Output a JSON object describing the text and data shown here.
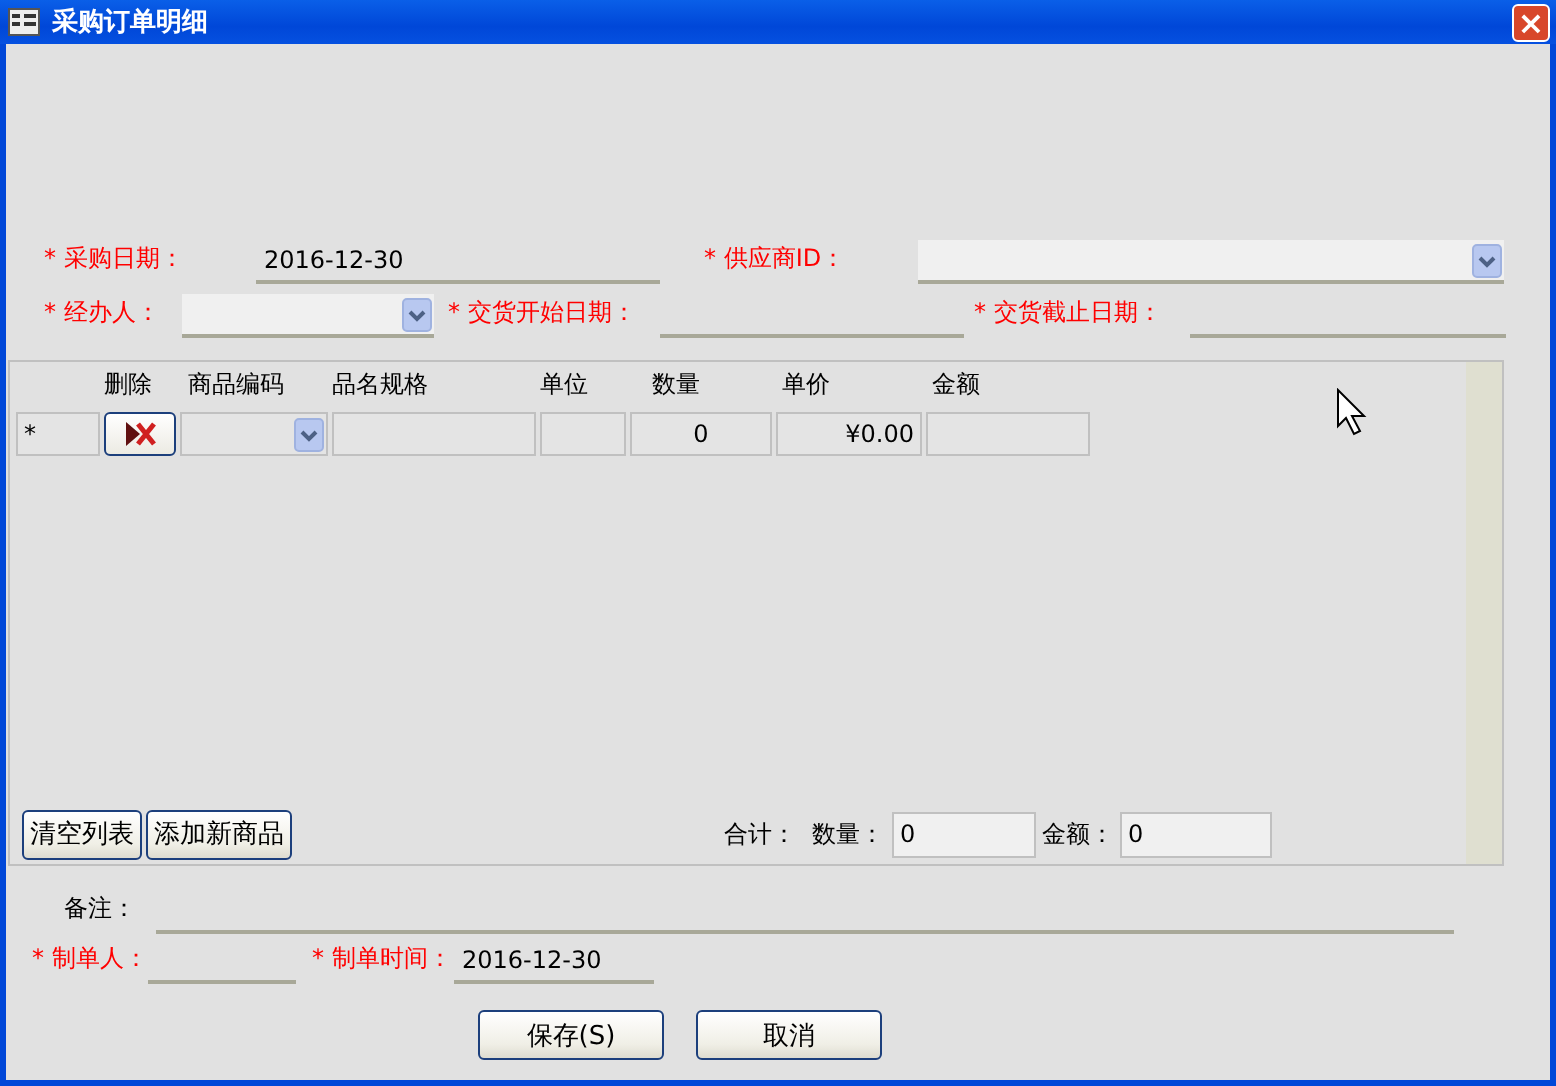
{
  "window": {
    "title": "采购订单明细",
    "close": "×"
  },
  "purchase_date": {
    "mark": "*",
    "label": "采购日期：",
    "required": true,
    "value": "2016-12-30"
  },
  "supplier_id": {
    "mark": "*",
    "label": "供应商ID：",
    "required": true
  },
  "handler": {
    "mark": "*",
    "label": "经办人：",
    "required": true
  },
  "delivery_start": {
    "mark": "*",
    "label": "交货开始日期：",
    "required": true
  },
  "delivery_end": {
    "mark": "*",
    "label": "交货截止日期：",
    "required": true
  },
  "grid": {
    "columns": [
      "删除",
      "商品编码",
      "品名规格",
      "单位",
      "数量",
      "单价",
      "金额"
    ],
    "rows": [
      {
        "marker": "*",
        "quantity": "0",
        "price": "¥0.00"
      }
    ],
    "buttons": [
      "清空列表",
      "添加新商品"
    ],
    "totals": {
      "label": "合计：",
      "quantity_label": "数量：",
      "quantity": "0",
      "amount_label": "金额：",
      "amount": "0"
    }
  },
  "remark": {
    "label": "备注：",
    "required": false
  },
  "creator": {
    "mark": "*",
    "label": "制单人：",
    "required": true
  },
  "created_time": {
    "mark": "*",
    "label": "制单时间：",
    "required": true,
    "value": "2016-12-30"
  },
  "buttons": [
    "保存(S)",
    "取消"
  ]
}
